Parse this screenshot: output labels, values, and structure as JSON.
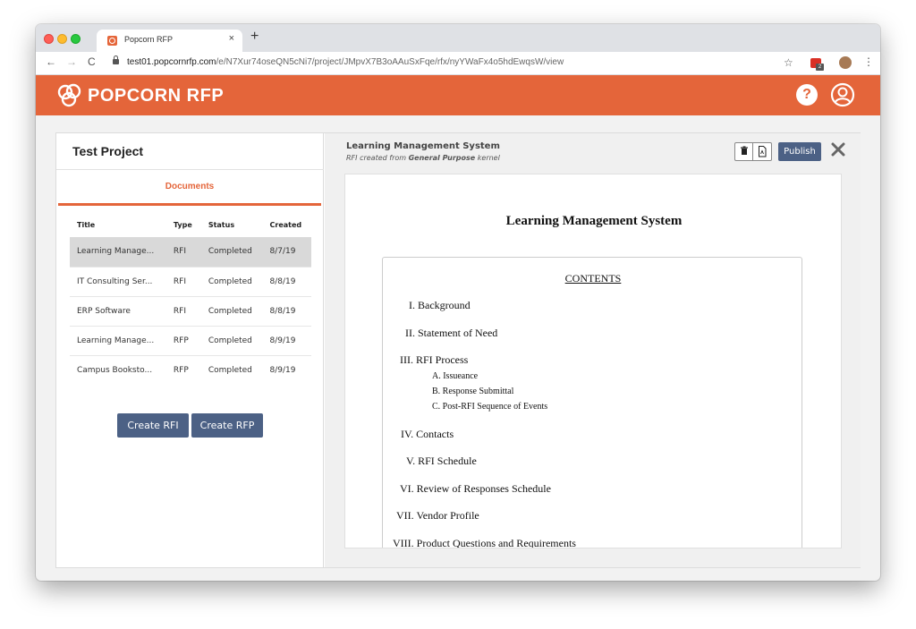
{
  "browser": {
    "tab_title": "Popcorn RFP",
    "tab_close": "×",
    "new_tab": "+",
    "back": "←",
    "forward": "→",
    "reload": "C",
    "url_host": "test01.popcornrfp.com",
    "url_path": "/e/N7Xur74oseQN5cNi7/project/JMpvX7B3oAAuSxFqe/rfx/nyYWaFx4o5hdEwqsW/view",
    "star": "☆",
    "ext_badge": "2",
    "menu": "⋮"
  },
  "header": {
    "brand": "POPCORN RFP",
    "help": "?",
    "color": "#e4653a"
  },
  "project": {
    "title": "Test Project",
    "tab_label": "Documents",
    "columns": [
      "Title",
      "Type",
      "Status",
      "Created"
    ],
    "rows": [
      {
        "title": "Learning Manage...",
        "type": "RFI",
        "status": "Completed",
        "created": "8/7/19"
      },
      {
        "title": "IT Consulting Ser...",
        "type": "RFI",
        "status": "Completed",
        "created": "8/8/19"
      },
      {
        "title": "ERP Software",
        "type": "RFI",
        "status": "Completed",
        "created": "8/8/19"
      },
      {
        "title": "Learning Manage...",
        "type": "RFP",
        "status": "Completed",
        "created": "8/9/19"
      },
      {
        "title": "Campus Booksto...",
        "type": "RFP",
        "status": "Completed",
        "created": "8/9/19"
      }
    ],
    "create_rfi": "Create RFI",
    "create_rfp": "Create RFP"
  },
  "document": {
    "name": "Learning Management System",
    "sub_prefix": "RFI created from ",
    "sub_kernel": "General Purpose",
    "sub_suffix": " kernel",
    "publish": "Publish",
    "preview_title": "Learning Management System",
    "contents_heading": "CONTENTS",
    "toc": [
      "I. Background",
      "II. Statement of Need",
      "III. RFI Process",
      "IV. Contacts",
      "V. RFI Schedule",
      "VI. Review of Responses Schedule",
      "VII. Vendor Profile",
      "VIII. Product Questions and Requirements"
    ],
    "toc_sub": [
      "A. Issueance",
      "B. Response Submittal",
      "C. Post-RFI Sequence of Events"
    ]
  }
}
